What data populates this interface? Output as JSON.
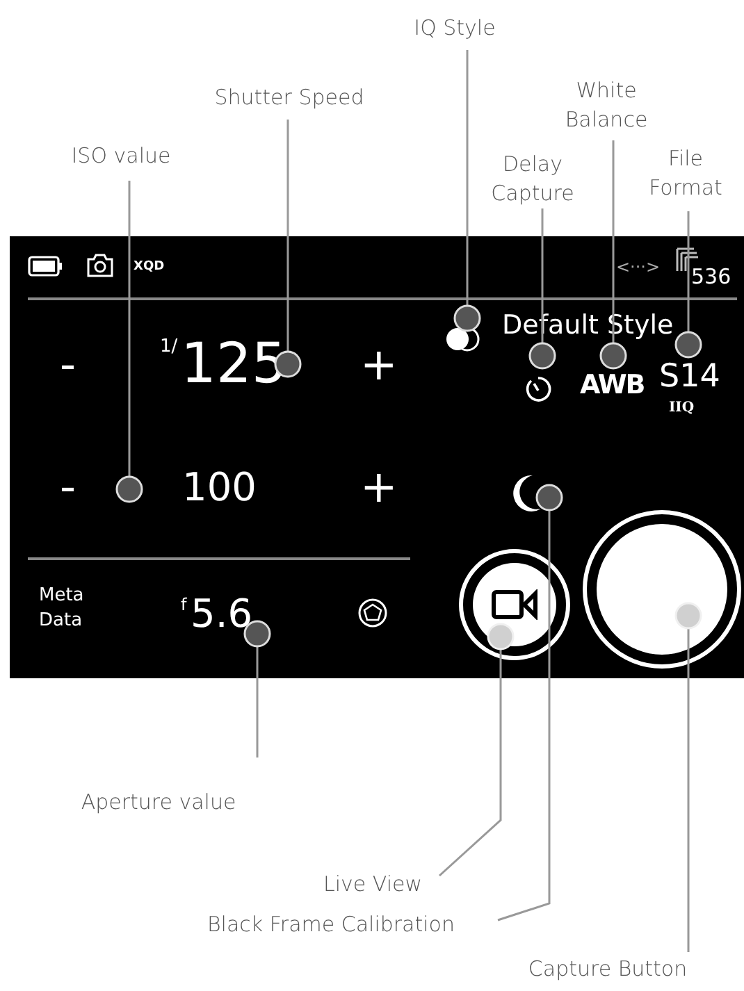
{
  "callouts": [
    {
      "label": "IQ Style"
    },
    {
      "label": "Shutter Speed"
    },
    {
      "label": "ISO value"
    },
    {
      "label": "Delay Capture"
    },
    {
      "label": "White Balance"
    },
    {
      "label": "File Format"
    },
    {
      "label": "Aperture value"
    },
    {
      "label": "Live View"
    },
    {
      "label": "Black Frame Calibration"
    },
    {
      "label": "Capture Button"
    }
  ],
  "screen": {
    "status_bar": {
      "storage": "XQD",
      "connection": "<···>",
      "shots_remaining": "536"
    },
    "shutter": {
      "minus": "-",
      "prefix": "1/",
      "value": "125",
      "plus": "+"
    },
    "iso": {
      "minus": "-",
      "value": "100",
      "plus": "+"
    },
    "iq_style": "Default Style",
    "white_balance": "AWB",
    "file_format": "S14",
    "file_type": "IIQ",
    "meta_data": "Meta Data",
    "aperture": {
      "prefix": "f",
      "value": "5.6"
    }
  }
}
